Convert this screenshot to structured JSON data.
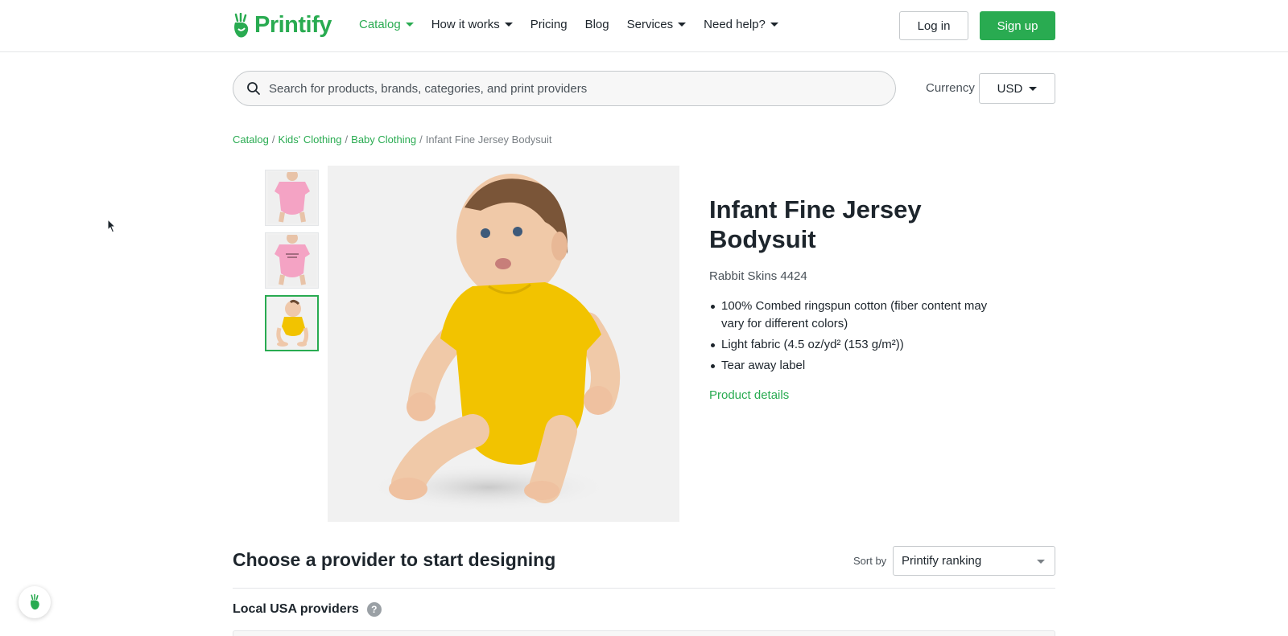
{
  "header": {
    "logo_text": "Printify",
    "nav": [
      {
        "label": "Catalog",
        "has_caret": true,
        "active": true
      },
      {
        "label": "How it works",
        "has_caret": true
      },
      {
        "label": "Pricing"
      },
      {
        "label": "Blog"
      },
      {
        "label": "Services",
        "has_caret": true
      },
      {
        "label": "Need help?",
        "has_caret": true
      }
    ],
    "login_label": "Log in",
    "signup_label": "Sign up"
  },
  "search": {
    "placeholder": "Search for products, brands, categories, and print providers",
    "value": ""
  },
  "currency": {
    "label": "Currency",
    "selected": "USD"
  },
  "breadcrumb": {
    "items": [
      "Catalog",
      "Kids' Clothing",
      "Baby Clothing"
    ],
    "separator": "/",
    "current": "Infant Fine Jersey Bodysuit"
  },
  "gallery": {
    "thumbnails": [
      {
        "color": "pink",
        "selected": false
      },
      {
        "color": "pink-printed",
        "selected": false
      },
      {
        "color": "yellow",
        "selected": true
      }
    ]
  },
  "product": {
    "title": "Infant Fine Jersey Bodysuit",
    "brand": "Rabbit Skins 4424",
    "features": [
      "100% Combed ringspun cotton (fiber content may vary for different colors)",
      "Light fabric (4.5 oz/yd² (153 g/m²))",
      "Tear away label"
    ],
    "details_link": "Product details"
  },
  "providers": {
    "title": "Choose a provider to start designing",
    "sort_label": "Sort by",
    "sort_selected": "Printify ranking",
    "local_title": "Local USA providers",
    "help_badge": "?"
  },
  "colors": {
    "brand_green": "#29ab51",
    "text_dark": "#1d252c",
    "bodysuit_yellow": "#f2c300",
    "bodysuit_pink": "#f4a3c4"
  }
}
